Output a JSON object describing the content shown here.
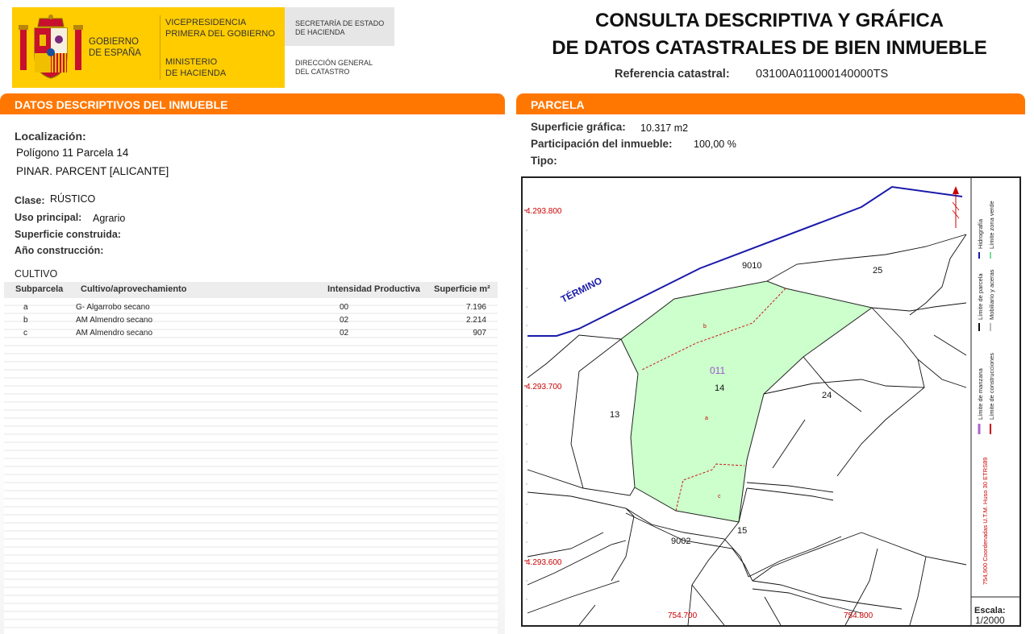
{
  "header": {
    "gov_line1": "GOBIERNO",
    "gov_line2": "DE ESPAÑA",
    "vice_line1": "VICEPRESIDENCIA",
    "vice_line2": "PRIMERA DEL GOBIERNO",
    "min_line1": "MINISTERIO",
    "min_line2": "DE HACIENDA",
    "sec_line1": "SECRETARÍA DE ESTADO",
    "sec_line2": "DE HACIENDA",
    "dir_line1": "DIRECCIÓN GENERAL",
    "dir_line2": "DEL CATASTRO",
    "title_line1": "CONSULTA DESCRIPTIVA Y GRÁFICA",
    "title_line2": "DE DATOS CATASTRALES DE BIEN INMUEBLE",
    "ref_label": "Referencia catastral:",
    "ref_value": "03100A011000140000TS"
  },
  "left": {
    "bar_title": "DATOS DESCRIPTIVOS DEL INMUEBLE",
    "loc_label": "Localización:",
    "loc_line1": "Polígono 11 Parcela 14",
    "loc_line2": "PINAR. PARCENT [ALICANTE]",
    "clase_label": "Clase:",
    "clase_value": "RÚSTICO",
    "uso_label": "Uso principal:",
    "uso_value": "Agrario",
    "sup_label": "Superficie construida:",
    "anio_label": "Año construcción:",
    "cultivo_title": "CULTIVO",
    "cultivo_headers": [
      "Subparcela",
      "Cultivo/aprovechamiento",
      "Intensidad Productiva",
      "Superficie m²"
    ],
    "cultivo_rows": [
      [
        "a",
        "G- Algarrobo secano",
        "00",
        "7.196"
      ],
      [
        "b",
        "AM Almendro secano",
        "02",
        "2.214"
      ],
      [
        "c",
        "AM Almendro secano",
        "02",
        "907"
      ]
    ]
  },
  "right": {
    "bar_title": "PARCELA",
    "supg_label": "Superficie gráfica:",
    "supg_value": "10.317 m2",
    "part_label": "Participación del inmueble:",
    "part_value": "100,00 %",
    "tipo_label": "Tipo:"
  },
  "map": {
    "y_labels": [
      "4.293.800",
      "4.293.700",
      "4.293.600"
    ],
    "x_labels": [
      "754.700",
      "754.800"
    ],
    "termino": "TÉRMINO",
    "parcel_labels": [
      "9010",
      "25",
      "011",
      "14",
      "24",
      "13",
      "15",
      "9002"
    ],
    "subparcel_labels": [
      "b",
      "a",
      "c"
    ],
    "legend": {
      "hidro": "Hidrografía",
      "zona_verde": "Límite zona verde",
      "parcela": "Límite de parcela",
      "mobiliario": "Mobiliario y aceras",
      "manzana": "Límite de manzana",
      "construcciones": "Límite de construcciones",
      "coords": "754,900 Coordenadas U.T.M. Huso 30 ETRS89"
    },
    "escala_label": "Escala:",
    "escala_value": "1/2000",
    "colors": {
      "parcel_fill": "#ccffcc",
      "termino_line": "#1a1aaa",
      "grid_text": "#cc0000",
      "bar_orange": "#ff7700"
    }
  }
}
